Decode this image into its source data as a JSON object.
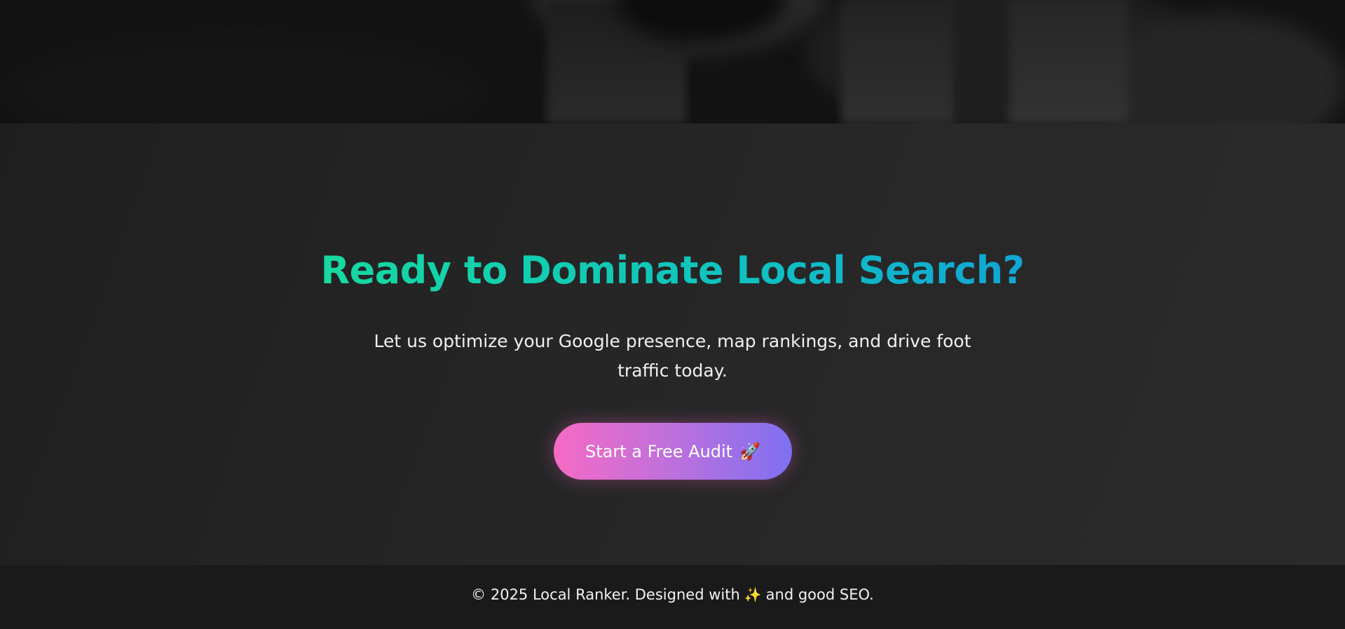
{
  "hero": {},
  "cta": {
    "title": "Ready to Dominate Local Search?",
    "subtitle": "Let us optimize your Google presence, map rankings, and drive foot traffic today.",
    "button_label": "Start a Free Audit",
    "button_icon": "🚀"
  },
  "footer": {
    "text_before": "© 2025 Local Ranker. Designed with",
    "icon": "✨",
    "text_after": "and good SEO."
  },
  "colors": {
    "title_gradient_start": "#16d9a0",
    "title_gradient_end": "#11a6d6",
    "button_gradient_start": "#f56bc5",
    "button_gradient_end": "#7e70f3",
    "background": "#262626",
    "footer_background": "#1a1a1a"
  }
}
